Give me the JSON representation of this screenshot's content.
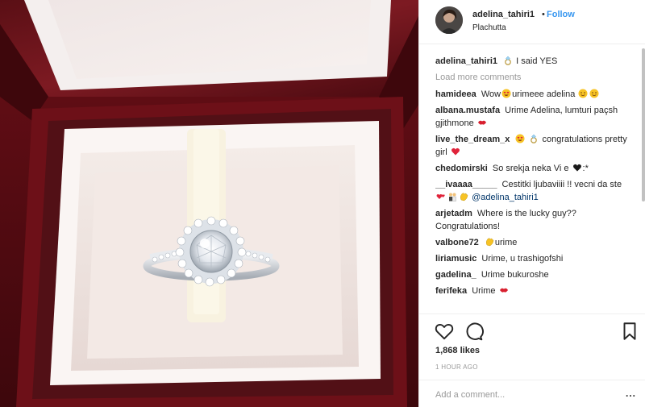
{
  "post": {
    "image_alt": "Diamond halo engagement ring in a red jewelry box",
    "header": {
      "username": "adelina_tahiri1",
      "dot": "•",
      "follow_label": "Follow",
      "location": "Plachutta"
    },
    "caption": {
      "username": "adelina_tahiri1",
      "emoji": "ring-emoji",
      "text": "I said YES"
    },
    "load_more_label": "Load more comments",
    "comments": [
      {
        "username": "hamideea",
        "parts": [
          "Wow",
          "urimeee adelina"
        ],
        "emojis": [
          "heart-eyes-emoji",
          "smiling-emoji",
          "smiling-emoji"
        ]
      },
      {
        "username": "albana.mustafa",
        "parts": [
          "Urime Adelina, lumturi paçsh gjithmone"
        ],
        "emojis": [
          "kiss-lips-emoji"
        ]
      },
      {
        "username": "live_the_dream_x",
        "parts": [
          "congratulations pretty girl"
        ],
        "emojis": [
          "heart-eyes-emoji",
          "ring-emoji",
          "heart-emoji"
        ]
      },
      {
        "username": "chedomirski",
        "parts": [
          "So srekja neka Vi e",
          ":*"
        ],
        "emojis": [
          "black-heart-emoji"
        ]
      },
      {
        "username": "__ivaaaa_____",
        "parts": [
          "Cestitki ljubaviiii !! vecni da ste",
          "@adelina_tahiri1"
        ],
        "emojis": [
          "hearts-emoji",
          "couple-emoji",
          "clap-emoji"
        ]
      },
      {
        "username": "arjetadm",
        "parts": [
          "Where is the lucky guy?? Congratulations!"
        ],
        "emojis": []
      },
      {
        "username": "valbone72",
        "parts": [
          "urime"
        ],
        "emojis": [
          "clap-emoji"
        ]
      },
      {
        "username": "liriamusic",
        "parts": [
          "Urime, u trashigofshi"
        ],
        "emojis": []
      },
      {
        "username": "gadelina_",
        "parts": [
          "Urime bukuroshe"
        ],
        "emojis": []
      },
      {
        "username": "ferifeka",
        "parts": [
          "Urime"
        ],
        "emojis": [
          "kiss-lips-emoji"
        ]
      }
    ],
    "likes_label": "1,868 likes",
    "time_label": "1 HOUR AGO",
    "add_comment_placeholder": "Add a comment...",
    "more_label": "..."
  },
  "icons": {
    "like": "heart-outline-icon",
    "comment": "speech-bubble-icon",
    "save": "bookmark-icon"
  },
  "colors": {
    "link_blue": "#3897f0",
    "mention_blue": "#003569",
    "muted_gray": "#999999",
    "text": "#262626",
    "box_red": "#6e1119"
  }
}
